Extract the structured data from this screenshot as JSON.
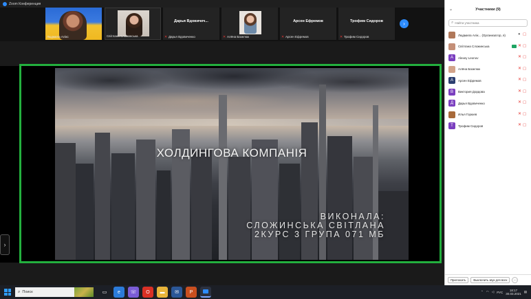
{
  "window": {
    "title": "Zoom Конференция"
  },
  "strip": {
    "tiles": [
      {
        "name": "Людмила Алікс"
      },
      {
        "name": "Світлана Сложинська"
      },
      {
        "big": "Дарья Вдовичеч...",
        "name": "Дарья Вдовиченко"
      },
      {
        "name": "Алёна Базелюк"
      },
      {
        "big": "Арсен Ефремов",
        "name": "Арсен Ефремов"
      },
      {
        "big": "Трофим Сидоров",
        "name": "Трофим Сидоров"
      }
    ]
  },
  "slide": {
    "title": "ХОЛДИНГОВА КОМПАНІЯ",
    "credit_line1": "ВИКОНАЛА:",
    "credit_line2": "СЛОЖИНСЬКА СВІТЛАНА",
    "credit_line3": "2КУРС 3 ГРУПА 071 МБ"
  },
  "panel": {
    "header": "Участники (9)",
    "search_placeholder": "Найти участника",
    "participants": [
      {
        "name": "Людмила Алік... (Организатор, я)",
        "initial": "",
        "color": "#b0785a"
      },
      {
        "name": "Світлана Сложинська",
        "initial": "",
        "color": "#c48f78"
      },
      {
        "name": "Alexey Leonov",
        "initial": "A",
        "color": "#7b3fbf"
      },
      {
        "name": "Алёна Базелюк",
        "initial": "",
        "color": "#d2a38a"
      },
      {
        "name": "Арсен Ефремов",
        "initial": "A",
        "color": "#2c3e70"
      },
      {
        "name": "Виктория Дордова",
        "initial": "B",
        "color": "#7b3fbf"
      },
      {
        "name": "Дарья Вдовиченко",
        "initial": "Д",
        "color": "#7b3fbf"
      },
      {
        "name": "Илья Горюев",
        "initial": "",
        "color": "#a86a3a"
      },
      {
        "name": "Трофим Сидоров",
        "initial": "T",
        "color": "#7b3fbf"
      }
    ],
    "invite_button": "Пригласить",
    "mute_all_button": "Выключить звук для всех",
    "more_label": "..."
  },
  "taskbar": {
    "search_label": "Поиск",
    "lang": "РУС",
    "time": "18:17",
    "date": "30.03.2021"
  }
}
